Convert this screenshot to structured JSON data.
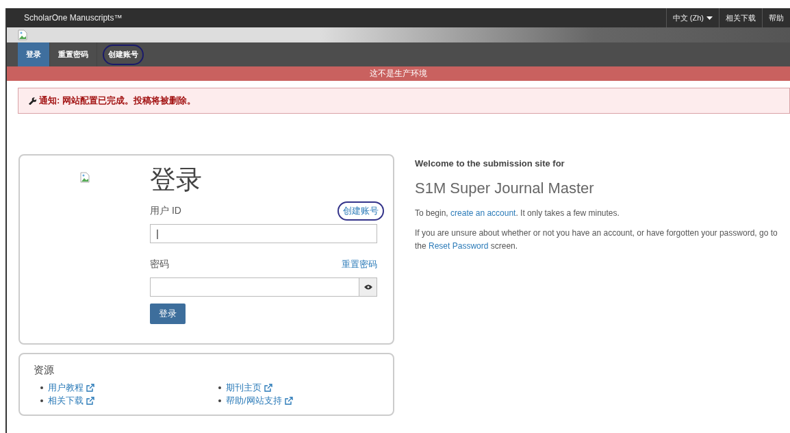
{
  "top_bar": {
    "brand": "ScholarOne Manuscripts™",
    "language": "中文 (Zh)",
    "links": [
      "相关下载",
      "帮助"
    ]
  },
  "nav_tabs": [
    {
      "label": "登录",
      "selected": true,
      "circled": false
    },
    {
      "label": "重置密码",
      "selected": false,
      "circled": false
    },
    {
      "label": "创建账号",
      "selected": false,
      "circled": true
    }
  ],
  "environment_banner": "这不是生产环境",
  "notice": "通知: 网站配置已完成。投稿将被删除。",
  "login": {
    "title": "登录",
    "user_id_label": "用户 ID",
    "create_account_link": {
      "label": "创建账号",
      "circled": true
    },
    "user_id_value": "|",
    "password_label": "密码",
    "reset_password_link": "重置密码",
    "submit": "登录"
  },
  "resources": {
    "title": "资源",
    "links": [
      {
        "label": "用户教程"
      },
      {
        "label": "期刊主页"
      },
      {
        "label": "相关下载"
      },
      {
        "label": "帮助/网站支持"
      }
    ]
  },
  "welcome": {
    "heading": "Welcome to the submission site for",
    "journal": "S1M Super Journal Master",
    "begin_text": [
      "To begin, ",
      "create an account",
      ". It only takes a few minutes."
    ],
    "unsure_text": [
      "If you are unsure about whether or not you have an account, or have forgotten your password, go to the ",
      "Reset Password",
      " screen."
    ]
  }
}
